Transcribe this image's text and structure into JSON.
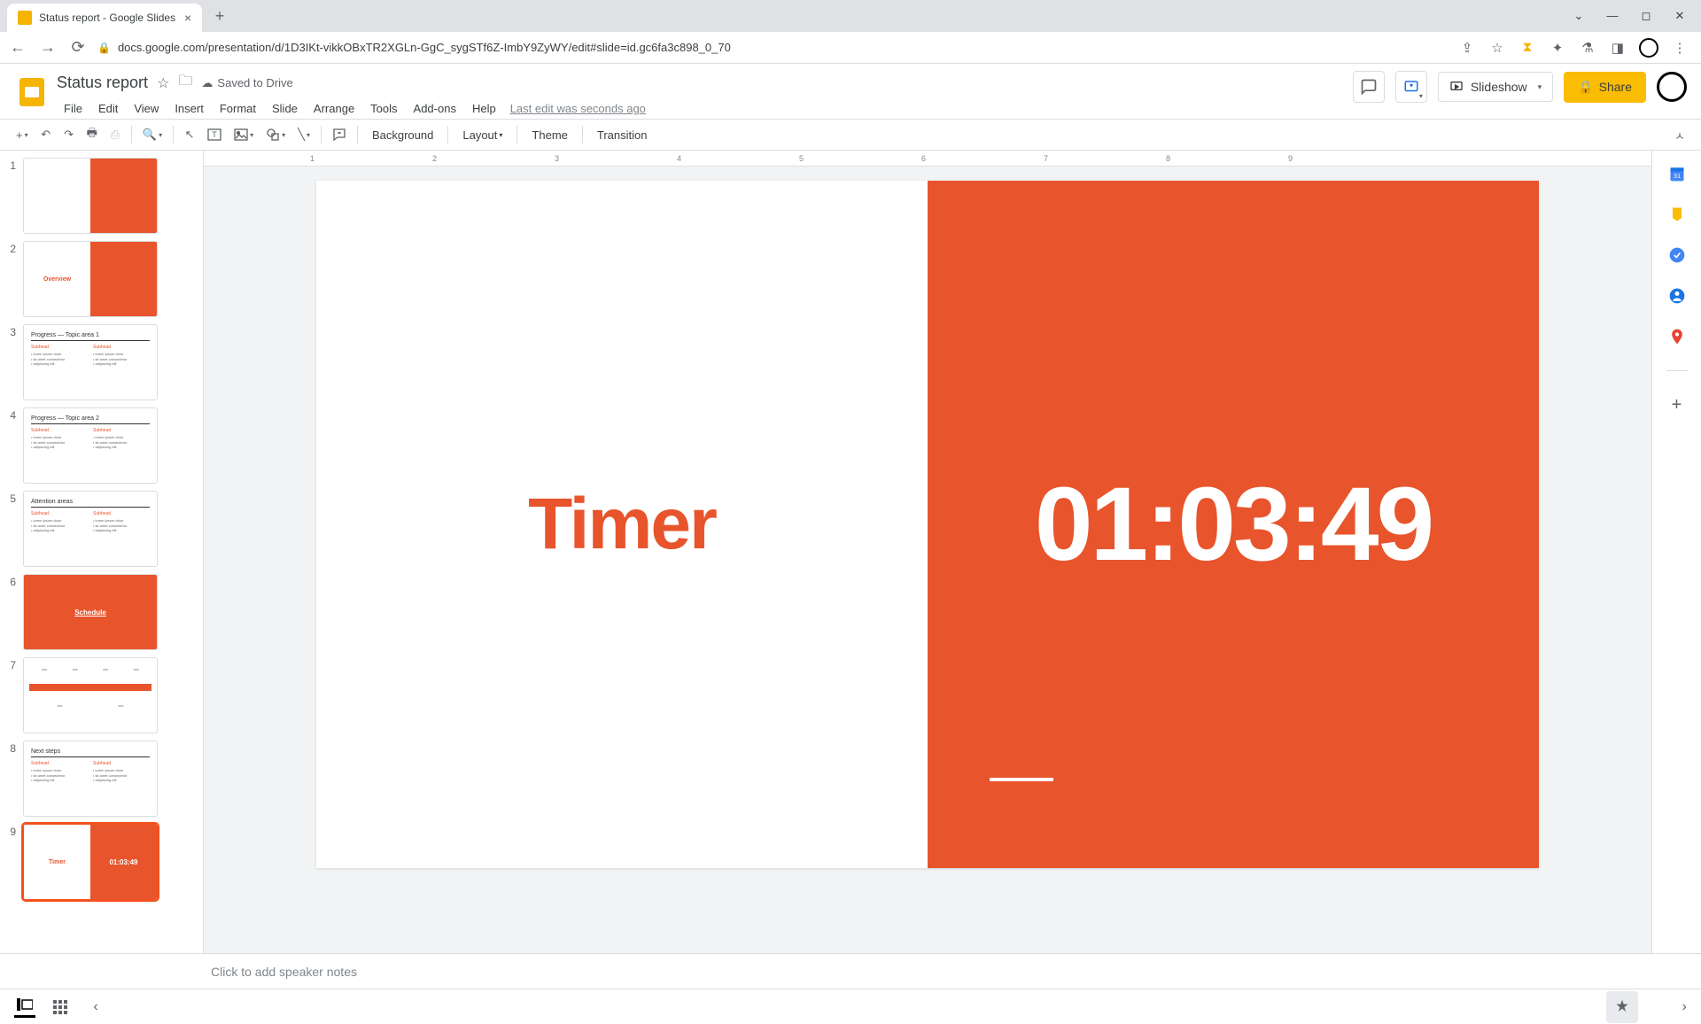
{
  "browser": {
    "tab_title": "Status report - Google Slides",
    "url": "docs.google.com/presentation/d/1D3IKt-vikkOBxTR2XGLn-GgC_sygSTf6Z-ImbY9ZyWY/edit#slide=id.gc6fa3c898_0_70"
  },
  "doc": {
    "title": "Status report",
    "saved_text": "Saved to Drive",
    "last_edit": "Last edit was seconds ago"
  },
  "menus": [
    "File",
    "Edit",
    "View",
    "Insert",
    "Format",
    "Slide",
    "Arrange",
    "Tools",
    "Add-ons",
    "Help"
  ],
  "header_buttons": {
    "slideshow": "Slideshow",
    "share": "Share"
  },
  "toolbar": {
    "background": "Background",
    "layout": "Layout",
    "theme": "Theme",
    "transition": "Transition"
  },
  "ruler_ticks": [
    "1",
    "2",
    "3",
    "4",
    "5",
    "6",
    "7",
    "8",
    "9"
  ],
  "slide": {
    "title": "Timer",
    "time": "01:03:49"
  },
  "thumbs": [
    {
      "n": "1",
      "type": "half",
      "l": "",
      "r": ""
    },
    {
      "n": "2",
      "type": "half",
      "l": "Overview",
      "r": ""
    },
    {
      "n": "3",
      "type": "text",
      "hdr": "Progress — Topic area 1"
    },
    {
      "n": "4",
      "type": "text",
      "hdr": "Progress — Topic area 2"
    },
    {
      "n": "5",
      "type": "text",
      "hdr": "Attention areas"
    },
    {
      "n": "6",
      "type": "orange",
      "center": "Schedule"
    },
    {
      "n": "7",
      "type": "timeline"
    },
    {
      "n": "8",
      "type": "text",
      "hdr": "Next steps"
    },
    {
      "n": "9",
      "type": "half",
      "l": "Timer",
      "r": "01:03:49",
      "selected": true
    }
  ],
  "notes_placeholder": "Click to add speaker notes",
  "colors": {
    "accent": "#e8542c",
    "share": "#fbbc04"
  }
}
